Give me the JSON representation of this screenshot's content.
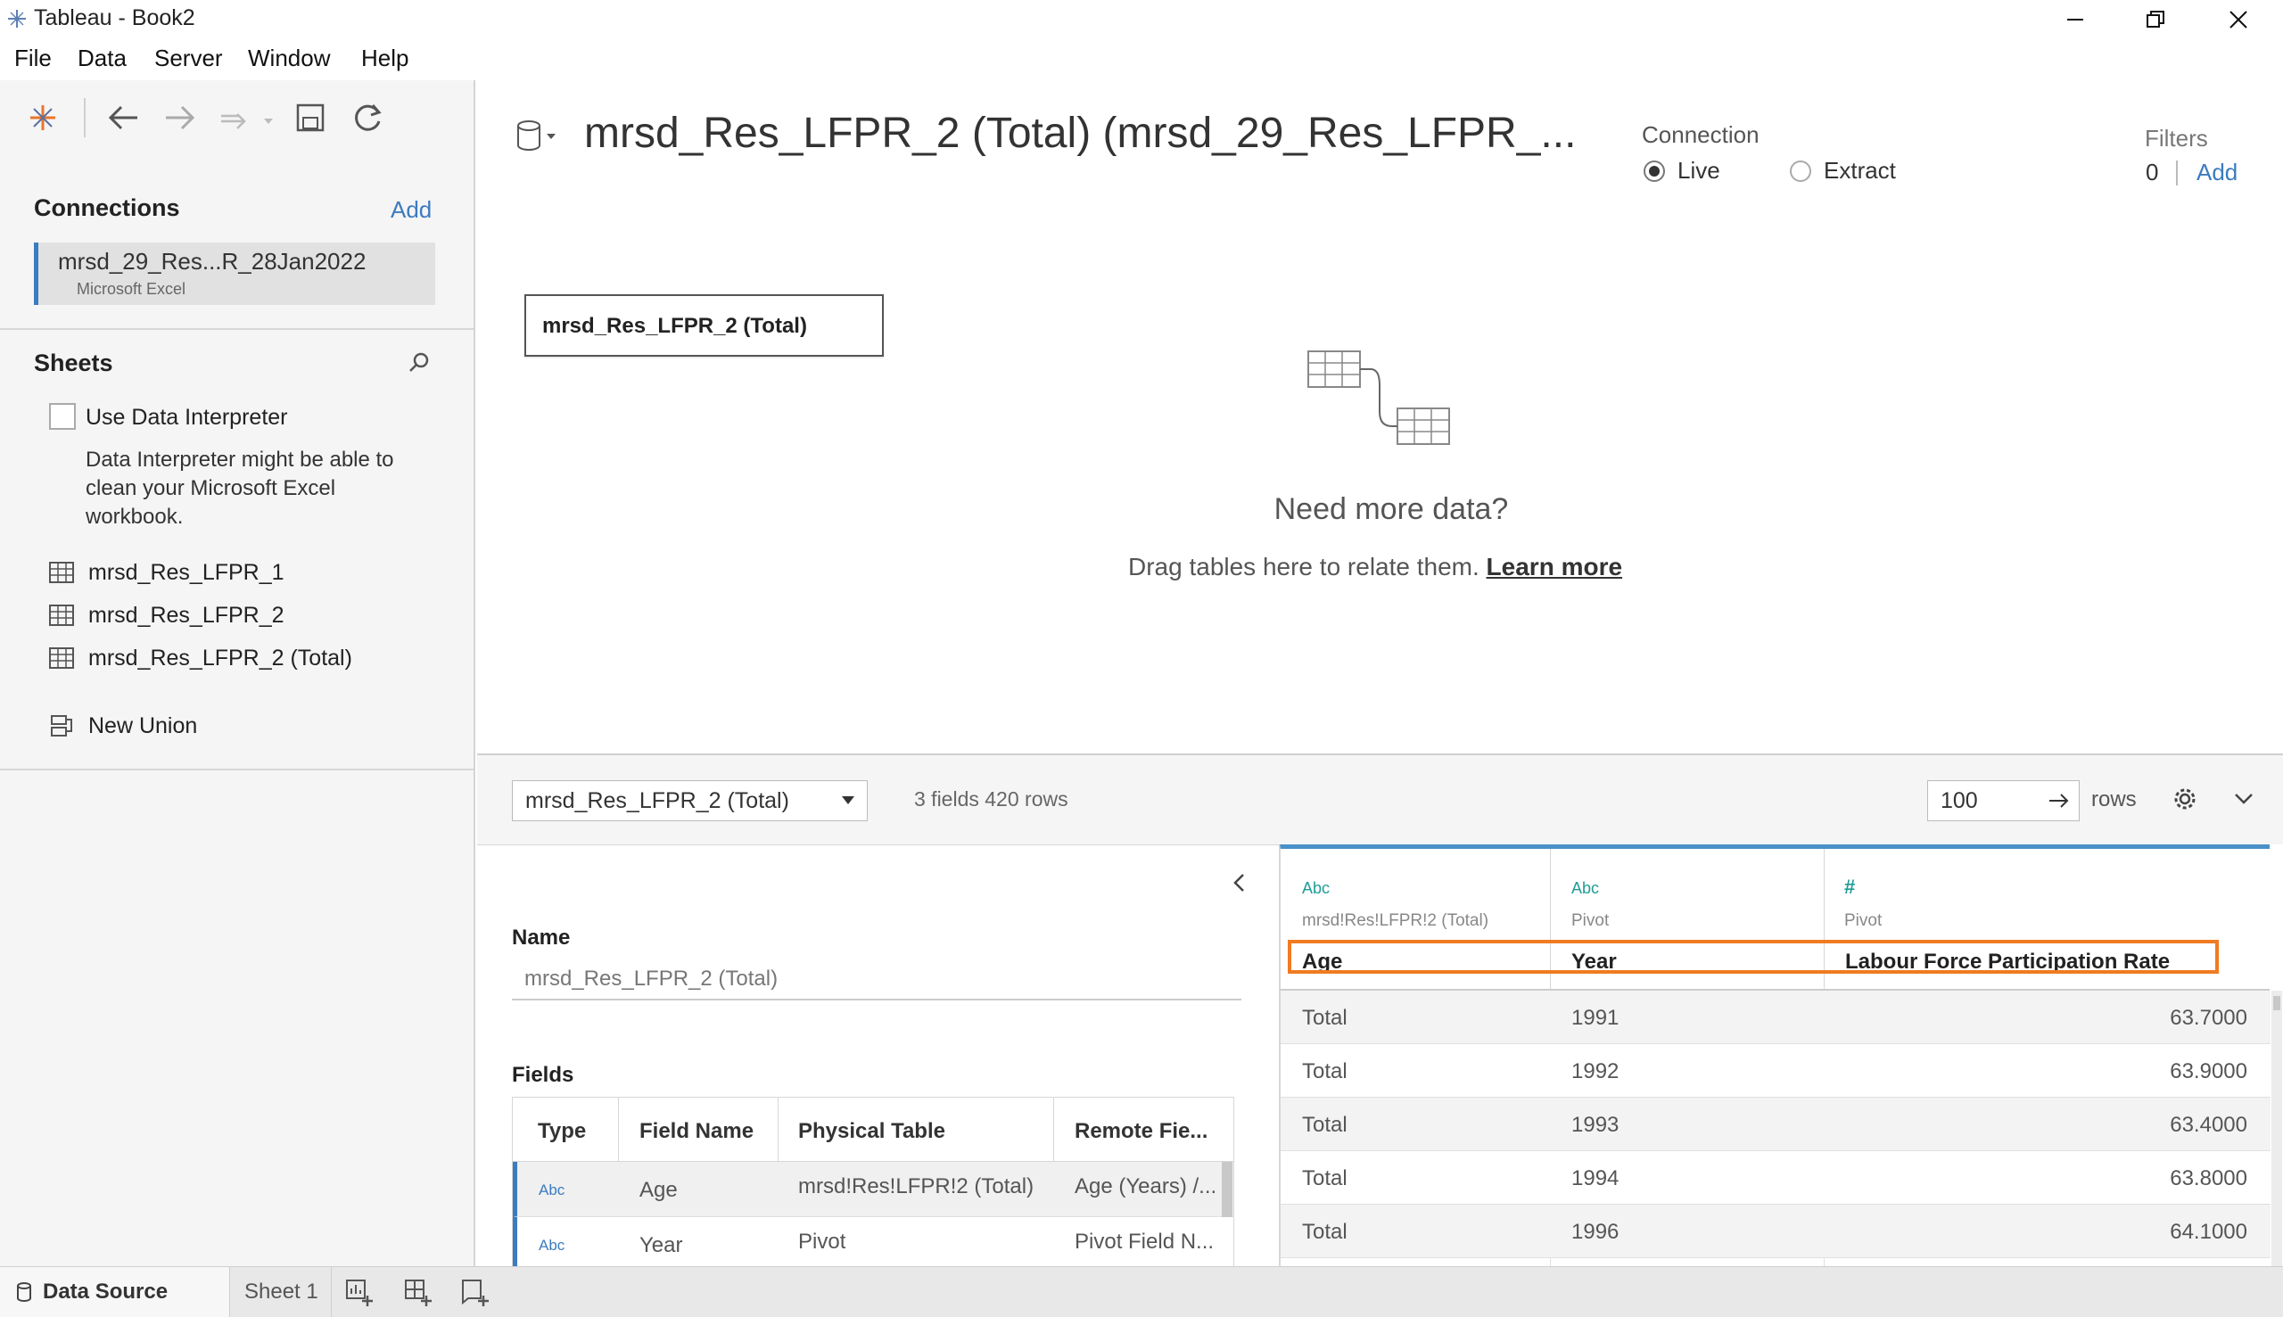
{
  "window": {
    "title": "Tableau - Book2",
    "minimize_glyph": "—",
    "restore_glyph": "❐",
    "close_glyph": "✕"
  },
  "menu": {
    "items": [
      "File",
      "Data",
      "Server",
      "Window",
      "Help"
    ]
  },
  "left": {
    "connections_title": "Connections",
    "add_label": "Add",
    "connection": {
      "name": "mrsd_29_Res...R_28Jan2022",
      "type": "Microsoft Excel"
    },
    "sheets_title": "Sheets",
    "use_interpreter_label": "Use Data Interpreter",
    "interpreter_help": [
      "Data Interpreter might be able to",
      "clean your Microsoft Excel",
      "workbook."
    ],
    "sheets": [
      "mrsd_Res_LFPR_1",
      "mrsd_Res_LFPR_2",
      "mrsd_Res_LFPR_2 (Total)"
    ],
    "new_union_label": "New Union"
  },
  "header": {
    "datasource_title": "mrsd_Res_LFPR_2 (Total) (mrsd_29_Res_LFPR_...",
    "connection_label": "Connection",
    "live_label": "Live",
    "extract_label": "Extract",
    "connection_mode": "Live",
    "filters_label": "Filters",
    "filters_count": "0",
    "filters_add": "Add"
  },
  "canvas": {
    "table_pill": "mrsd_Res_LFPR_2 (Total)",
    "need_more_title": "Need more data?",
    "drag_text": "Drag tables here to relate them.",
    "learn_more": "Learn more"
  },
  "preview_toolbar": {
    "table_select": "mrsd_Res_LFPR_2 (Total)",
    "summary": "3 fields 420 rows",
    "rows_value": "100",
    "rows_label": "rows"
  },
  "metadata": {
    "name_label": "Name",
    "name_value": "mrsd_Res_LFPR_2 (Total)",
    "fields_label": "Fields",
    "columns": [
      "Type",
      "Field Name",
      "Physical Table",
      "Remote Fie..."
    ],
    "rows": [
      {
        "type": "Abc",
        "field": "Age",
        "table": "mrsd!Res!LFPR!2 (Total)",
        "remote": "Age (Years) /..."
      },
      {
        "type": "Abc",
        "field": "Year",
        "table": "Pivot",
        "remote": "Pivot Field N..."
      }
    ]
  },
  "grid": {
    "columns": [
      {
        "type_icon": "Abc",
        "source": "mrsd!Res!LFPR!2 (Total)",
        "name": "Age"
      },
      {
        "type_icon": "Abc",
        "source": "Pivot",
        "name": "Year"
      },
      {
        "type_icon": "#",
        "source": "Pivot",
        "name": "Labour Force Participation Rate"
      }
    ],
    "rows": [
      [
        "Total",
        "1991",
        "63.7000"
      ],
      [
        "Total",
        "1992",
        "63.9000"
      ],
      [
        "Total",
        "1993",
        "63.4000"
      ],
      [
        "Total",
        "1994",
        "63.8000"
      ],
      [
        "Total",
        "1996",
        "64.1000"
      ]
    ]
  },
  "tabs": {
    "data_source": "Data Source",
    "sheet1": "Sheet 1"
  },
  "colors": {
    "accent_blue": "#3b7bbf",
    "highlight_orange": "#f07b22",
    "teal": "#1f9c96",
    "grid_header_rule": "#4a90c8"
  }
}
